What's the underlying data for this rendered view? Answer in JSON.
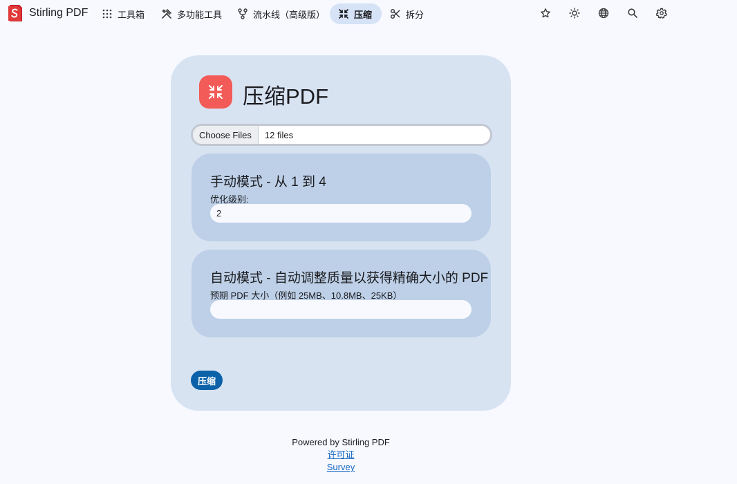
{
  "app": {
    "name": "Stirling PDF"
  },
  "nav": {
    "items": [
      {
        "label": "工具箱",
        "icon": "grid-icon"
      },
      {
        "label": "多功能工具",
        "icon": "tools-icon"
      },
      {
        "label": "流水线（高级版）",
        "icon": "pipeline-icon"
      },
      {
        "label": "压缩",
        "icon": "compress-icon",
        "active": true
      },
      {
        "label": "拆分",
        "icon": "scissors-icon"
      }
    ],
    "right_icons": [
      "star-icon",
      "brightness-icon",
      "globe-icon",
      "search-icon",
      "gear-icon"
    ]
  },
  "tool": {
    "title": "压缩PDF",
    "icon": "compress-icon",
    "icon_color": "#f25b57",
    "file_input": {
      "button_label": "Choose Files",
      "status": "12 files"
    },
    "manual": {
      "title": "手动模式 - 从 1 到 4",
      "label": "优化级别:",
      "value": "2"
    },
    "auto": {
      "title": "自动模式 - 自动调整质量以获得精确大小的 PDF",
      "label": "预期 PDF 大小（例如 25MB、10.8MB、25KB）",
      "value": ""
    },
    "submit_label": "压缩",
    "accent": "#0b62a8"
  },
  "footer": {
    "powered_by": "Powered by Stirling PDF",
    "links": [
      "许可证",
      "Survey"
    ]
  }
}
